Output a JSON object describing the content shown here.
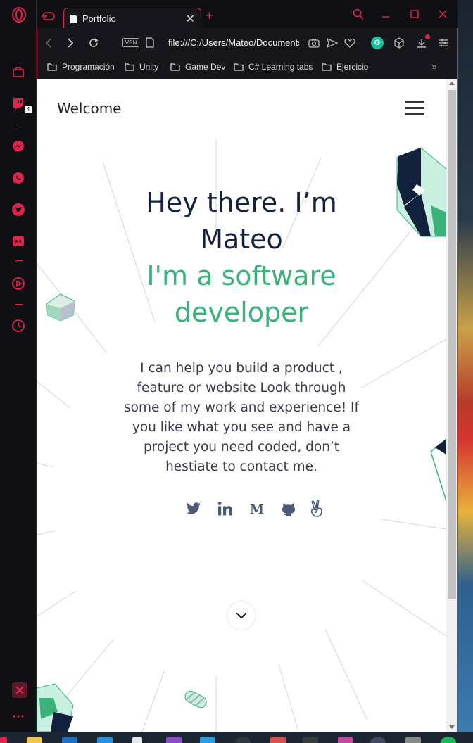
{
  "browser": {
    "tab_title": "Portfolio",
    "url": "file:///C:/Users/Mateo/Documents/Portfolio/index.html",
    "vpn_label": "VPN",
    "sidebar_badge_count": "4",
    "bookmarks": [
      "Programación",
      "Unity",
      "Game Dev",
      "C# Learning tabs",
      "Ejercicio"
    ],
    "accent_color": "#e0254a"
  },
  "page": {
    "brand": "Welcome",
    "hero_title_line1": "Hey there. I’m",
    "hero_title_line2": "Mateo",
    "hero_sub_line1": "I'm a software",
    "hero_sub_line2": "developer",
    "hero_text": "I can help you build a product , feature or website Look through some of my work and experience! If you like what you see and have a project you need coded, don’t hestiate to contact me.",
    "socials": [
      "twitter-icon",
      "linkedin-icon",
      "medium-icon",
      "github-icon",
      "angellist-icon"
    ],
    "title_color": "#14213d",
    "subtitle_color": "#3ab27a"
  }
}
